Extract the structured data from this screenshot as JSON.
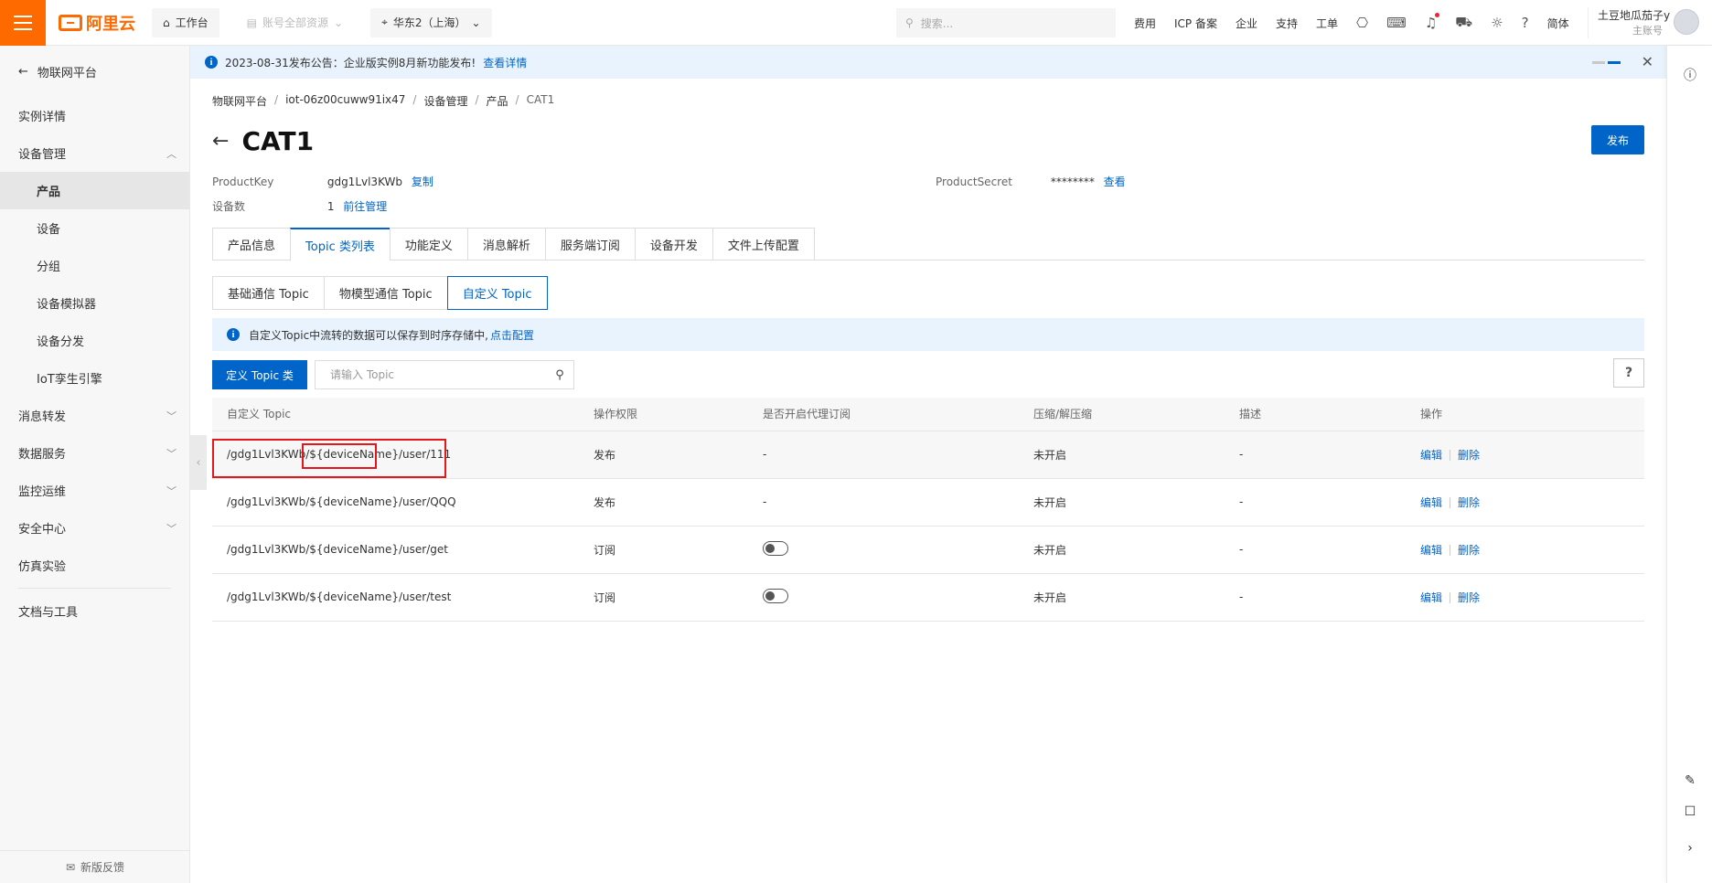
{
  "topbar": {
    "brand": "阿里云",
    "workbench": "工作台",
    "resources": "账号全部资源",
    "region": "华东2（上海）",
    "search_placeholder": "搜索...",
    "links": [
      "费用",
      "ICP 备案",
      "企业",
      "支持",
      "工单"
    ],
    "lang": "简体",
    "user_name": "土豆地瓜茄子y",
    "user_role": "主账号"
  },
  "notice": {
    "text": "2023-08-31发布公告：企业版实例8月新功能发布!",
    "link": "查看详情"
  },
  "sidebar": {
    "back_label": "物联网平台",
    "items": [
      {
        "label": "实例详情"
      },
      {
        "label": "设备管理"
      },
      {
        "label": "产品"
      },
      {
        "label": "设备"
      },
      {
        "label": "分组"
      },
      {
        "label": "设备模拟器"
      },
      {
        "label": "设备分发"
      },
      {
        "label": "IoT孪生引擎"
      },
      {
        "label": "消息转发"
      },
      {
        "label": "数据服务"
      },
      {
        "label": "监控运维"
      },
      {
        "label": "安全中心"
      },
      {
        "label": "仿真实验"
      },
      {
        "label": "文档与工具"
      }
    ],
    "feedback": "新版反馈"
  },
  "breadcrumb": [
    "物联网平台",
    "iot-06z00cuww91ix47",
    "设备管理",
    "产品",
    "CAT1"
  ],
  "page": {
    "title": "CAT1",
    "publish": "发布",
    "product_key_label": "ProductKey",
    "product_key": "gdg1Lvl3KWb",
    "copy": "复制",
    "device_count_label": "设备数",
    "device_count": "1",
    "manage": "前往管理",
    "product_secret_label": "ProductSecret",
    "product_secret": "********",
    "view": "查看"
  },
  "tabs": [
    "产品信息",
    "Topic 类列表",
    "功能定义",
    "消息解析",
    "服务端订阅",
    "设备开发",
    "文件上传配置"
  ],
  "subtabs": [
    "基础通信 Topic",
    "物模型通信 Topic",
    "自定义 Topic"
  ],
  "tip": {
    "text": "自定义Topic中流转的数据可以保存到时序存储中,",
    "link": "点击配置"
  },
  "toolbar": {
    "define_button": "定义 Topic 类",
    "search_placeholder": "请输入 Topic",
    "help": "?"
  },
  "table": {
    "headers": [
      "自定义 Topic",
      "操作权限",
      "是否开启代理订阅",
      "压缩/解压缩",
      "描述",
      "操作"
    ],
    "rows": [
      {
        "topic": "/gdg1Lvl3KWb/${deviceName}/user/111",
        "perm": "发布",
        "proxy": "-",
        "compress": "未开启",
        "desc": "-",
        "edit": "编辑",
        "del": "删除"
      },
      {
        "topic": "/gdg1Lvl3KWb/${deviceName}/user/QQQ",
        "perm": "发布",
        "proxy": "-",
        "compress": "未开启",
        "desc": "-",
        "edit": "编辑",
        "del": "删除"
      },
      {
        "topic": "/gdg1Lvl3KWb/${deviceName}/user/get",
        "perm": "订阅",
        "proxy": "",
        "compress": "未开启",
        "desc": "-",
        "edit": "编辑",
        "del": "删除"
      },
      {
        "topic": "/gdg1Lvl3KWb/${deviceName}/user/test",
        "perm": "订阅",
        "proxy": "",
        "compress": "未开启",
        "desc": "-",
        "edit": "编辑",
        "del": "删除"
      }
    ]
  },
  "colors": {
    "brand": "#ff6a00",
    "primary": "#0064c8",
    "highlight": "#e5171b"
  }
}
